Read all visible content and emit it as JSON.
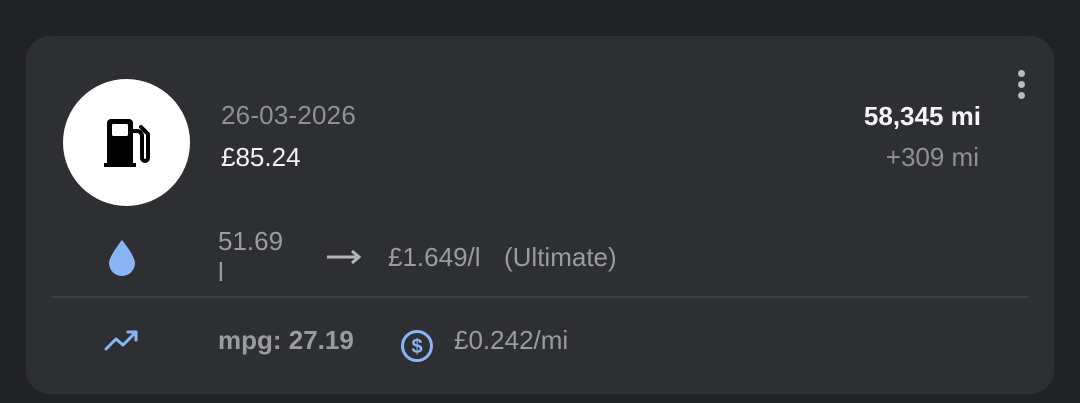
{
  "entry": {
    "date": "26-03-2026",
    "total_cost": "£85.24",
    "odometer": "58,345 mi",
    "distance": "+309 mi"
  },
  "fuel": {
    "volume": "51.69 l",
    "price_per_litre": "£1.649/l",
    "grade": "(Ultimate)"
  },
  "stats": {
    "mpg": "mpg: 27.19",
    "cost_per_mile": "£0.242/mi"
  },
  "icons": {
    "main": "fuel-pump-icon",
    "menu": "more-vertical-icon",
    "fuel": "water-drop-icon",
    "arrow": "arrow-right-icon",
    "stats": "trending-up-icon",
    "cost": "dollar-circle-icon"
  },
  "colors": {
    "background": "#212226",
    "card": "#2e2f33",
    "accent_blue": "#8ab4f8",
    "primary_text": "#f2f2f2",
    "secondary_text": "#8f9095"
  }
}
